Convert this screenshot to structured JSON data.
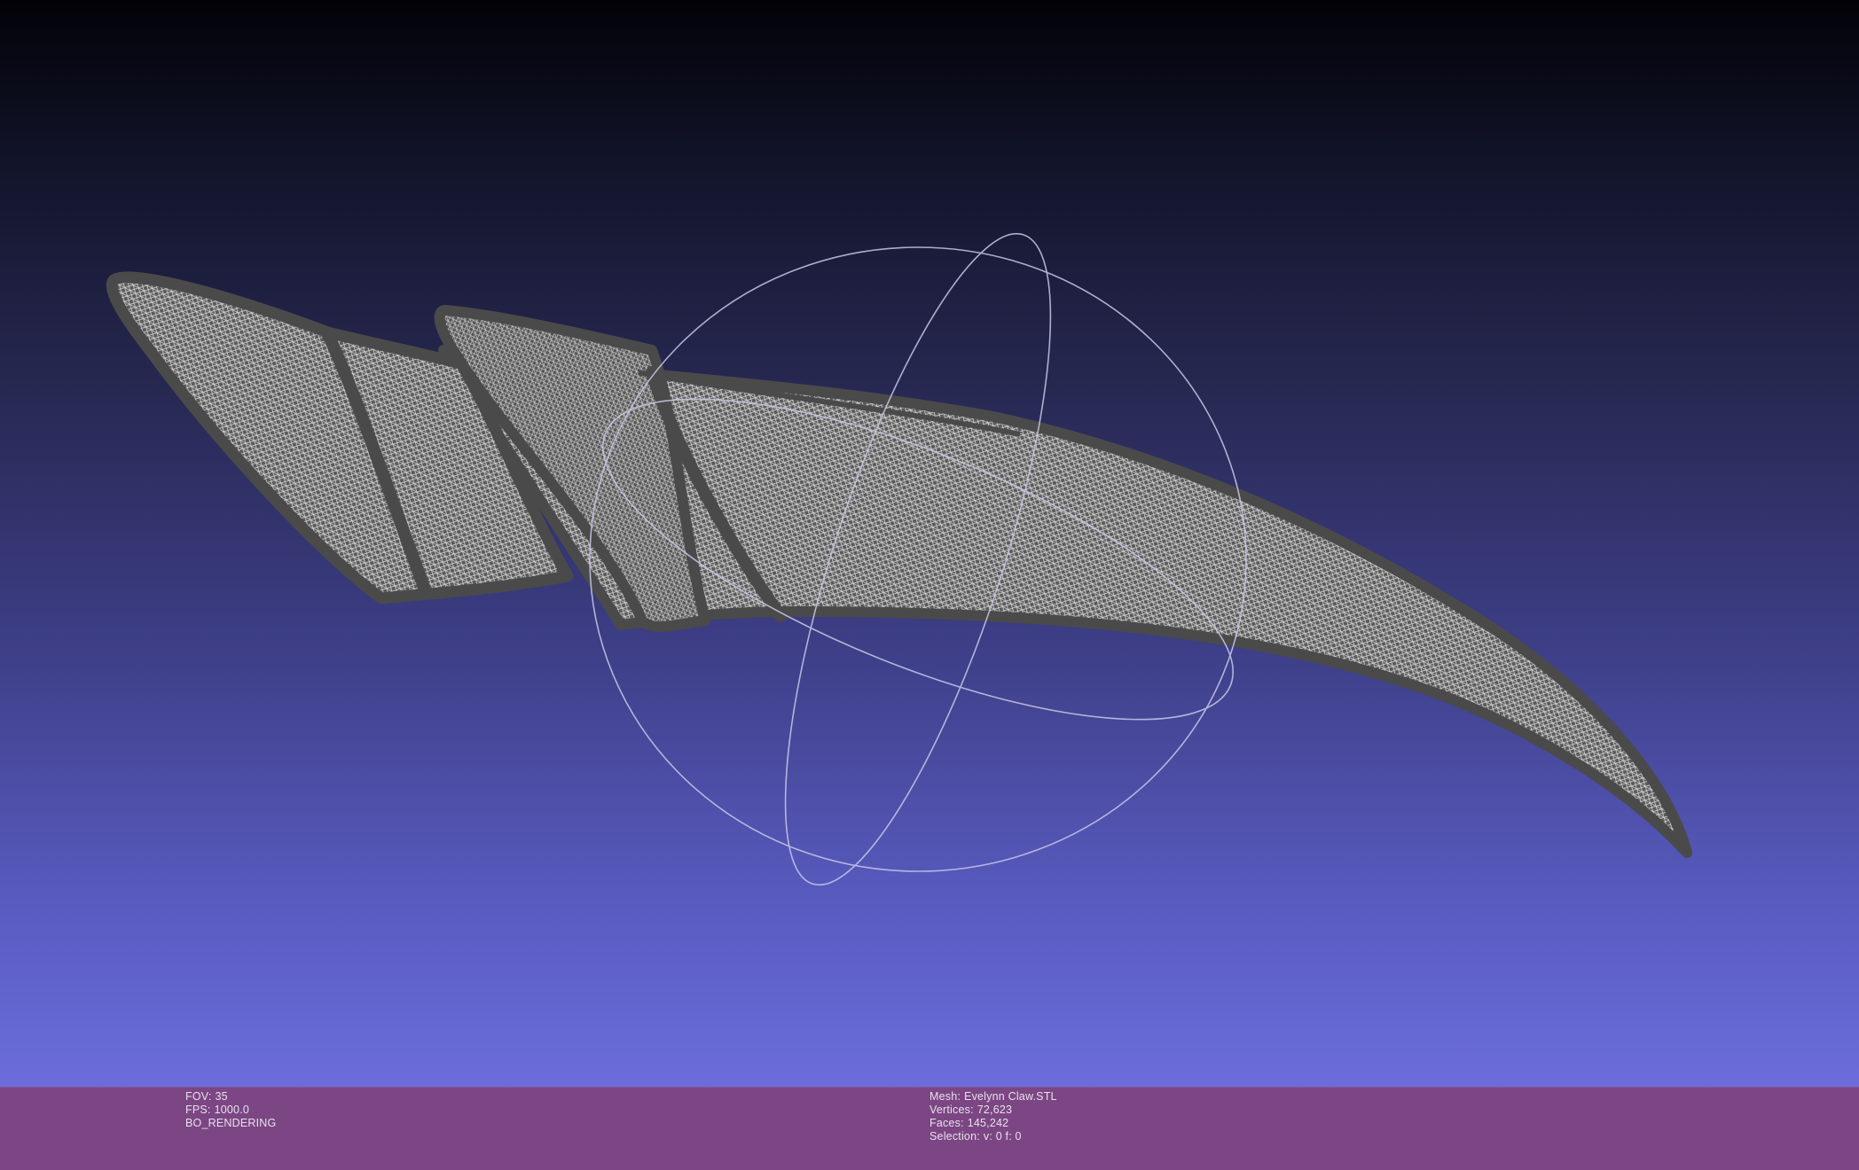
{
  "viewport": {
    "background_top": "#020207",
    "background_bottom": "#7475e7",
    "mesh_color": "#4a4a4a",
    "wire_color": "#c9c9c9",
    "trackball_color": "#c8c8e8"
  },
  "status_bar": {
    "background": "#7c4684",
    "fov": {
      "label": "FOV:",
      "value": "35"
    },
    "fps": {
      "label": "FPS:",
      "value": "1000.0"
    },
    "render_mode": "BO_RENDERING",
    "mesh": {
      "label": "Mesh:",
      "value": "Evelynn Claw.STL"
    },
    "vertices": {
      "label": "Vertices:",
      "value": "72,623"
    },
    "faces": {
      "label": "Faces:",
      "value": "145,242"
    },
    "selection": {
      "label": "Selection:",
      "value": "v: 0 f: 0"
    }
  }
}
